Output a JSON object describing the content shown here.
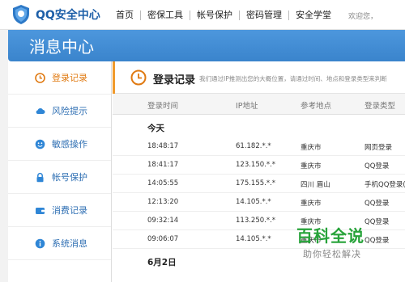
{
  "header": {
    "logo_text": "QQ安全中心",
    "nav": [
      "首页",
      "密保工具",
      "帐号保护",
      "密码管理",
      "安全学堂"
    ],
    "welcome": "欢迎您，"
  },
  "banner": {
    "title": "消息中心"
  },
  "sidebar": {
    "items": [
      {
        "label": "登录记录",
        "icon": "clock-icon",
        "active": true
      },
      {
        "label": "风险提示",
        "icon": "cloud-icon"
      },
      {
        "label": "敏感操作",
        "icon": "face-icon"
      },
      {
        "label": "帐号保护",
        "icon": "lock-icon"
      },
      {
        "label": "消费记录",
        "icon": "wallet-icon"
      },
      {
        "label": "系统消息",
        "icon": "info-icon"
      }
    ]
  },
  "main": {
    "title": "登录记录",
    "description": "我们通过IP推测出您的大概位置，请通过时间、地点和登录类型来判断",
    "columns": [
      "登录时间",
      "IP地址",
      "参考地点",
      "登录类型"
    ],
    "groups": [
      {
        "label": "今天",
        "rows": [
          {
            "time": "18:48:17",
            "ip": "61.182.*.*",
            "place": "重庆市",
            "type": "网页登录"
          },
          {
            "time": "18:41:17",
            "ip": "123.150.*.*",
            "place": "重庆市",
            "type": "QQ登录"
          },
          {
            "time": "14:05:55",
            "ip": "175.155.*.*",
            "place": "四川 眉山",
            "type": "手机QQ登录("
          },
          {
            "time": "12:13:20",
            "ip": "14.105.*.*",
            "place": "重庆市",
            "type": "QQ登录"
          },
          {
            "time": "09:32:14",
            "ip": "113.250.*.*",
            "place": "重庆市",
            "type": "QQ登录"
          },
          {
            "time": "09:06:07",
            "ip": "14.105.*.*",
            "place": "重庆市",
            "type": "QQ登录"
          }
        ]
      },
      {
        "label": "6月2日",
        "rows": []
      }
    ]
  },
  "watermark": {
    "main": "百科全说",
    "sub": "助你轻松解决"
  },
  "colors": {
    "brand_blue": "#3a84cc",
    "active_orange": "#e07a12",
    "link_blue": "#2f6fb3",
    "watermark_green": "#27a33a"
  }
}
